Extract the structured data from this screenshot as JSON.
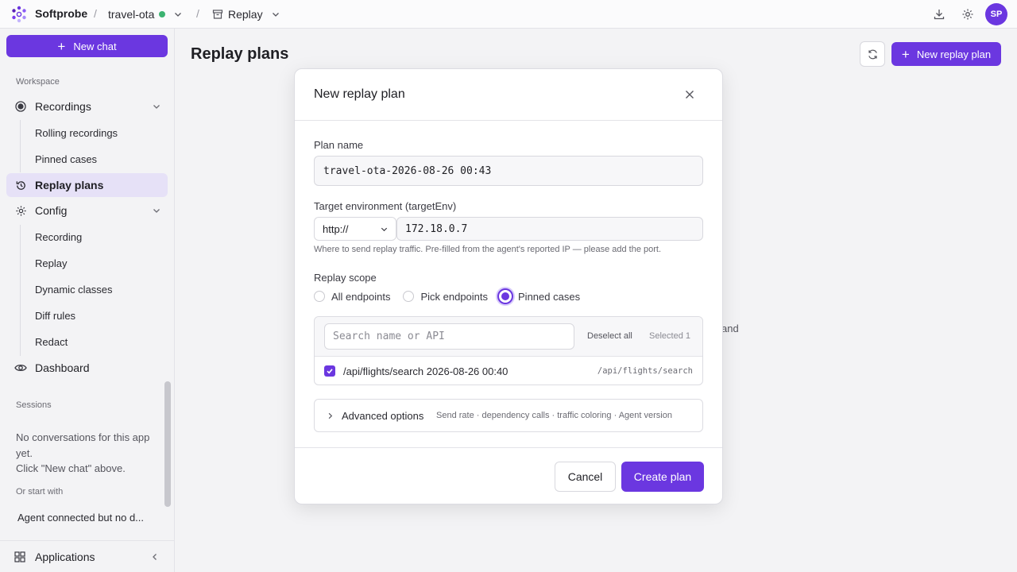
{
  "topbar": {
    "brand": "Softprobe",
    "separator": "/",
    "app": "travel-ota",
    "app_status_color": "#3cb371",
    "page": "Replay",
    "icons": [
      "download-icon",
      "settings-icon"
    ],
    "avatar": "SP"
  },
  "sidebar": {
    "new_chat": "New chat",
    "workspace_label": "Workspace",
    "recordings": "Recordings",
    "recordings_sub": [
      "Rolling recordings",
      "Pinned cases"
    ],
    "replay_plans": "Replay plans",
    "config": "Config",
    "config_sub": [
      "Recording",
      "Replay",
      "Dynamic classes",
      "Diff rules",
      "Redact"
    ],
    "dashboard": "Dashboard",
    "sessions_label": "Sessions",
    "sessions_empty_1": "No conversations for this app yet.",
    "sessions_empty_2": "Click \"New chat\" above.",
    "start_with_label": "Or start with",
    "start_item": "Agent connected but no d...",
    "applications": "Applications"
  },
  "main": {
    "title": "Replay plans",
    "new_plan_button": "New replay plan",
    "peek_text": "and"
  },
  "modal": {
    "title": "New replay plan",
    "plan_name_label": "Plan name",
    "plan_name_value": "travel-ota-2026-08-26 00:43",
    "target_env_label": "Target environment (targetEnv)",
    "protocol": "http://",
    "host": "172.18.0.7",
    "hint": "Where to send replay traffic. Pre-filled from the agent's reported IP — please add the port.",
    "scope_label": "Replay scope",
    "scope_options": [
      "All endpoints",
      "Pick endpoints",
      "Pinned cases"
    ],
    "scope_selected": "Pinned cases",
    "search_placeholder": "Search name or API",
    "deselect_all": "Deselect all",
    "selected_count": "Selected 1",
    "cases": [
      {
        "name": "/api/flights/search 2026-08-26 00:40",
        "api": "/api/flights/search",
        "checked": true
      }
    ],
    "advanced_title": "Advanced options",
    "advanced_desc": "Send rate · dependency calls · traffic coloring · Agent version",
    "cancel": "Cancel",
    "create": "Create plan"
  },
  "colors": {
    "accent": "#6b37e0",
    "active_nav_bg": "#e6e1f7"
  }
}
